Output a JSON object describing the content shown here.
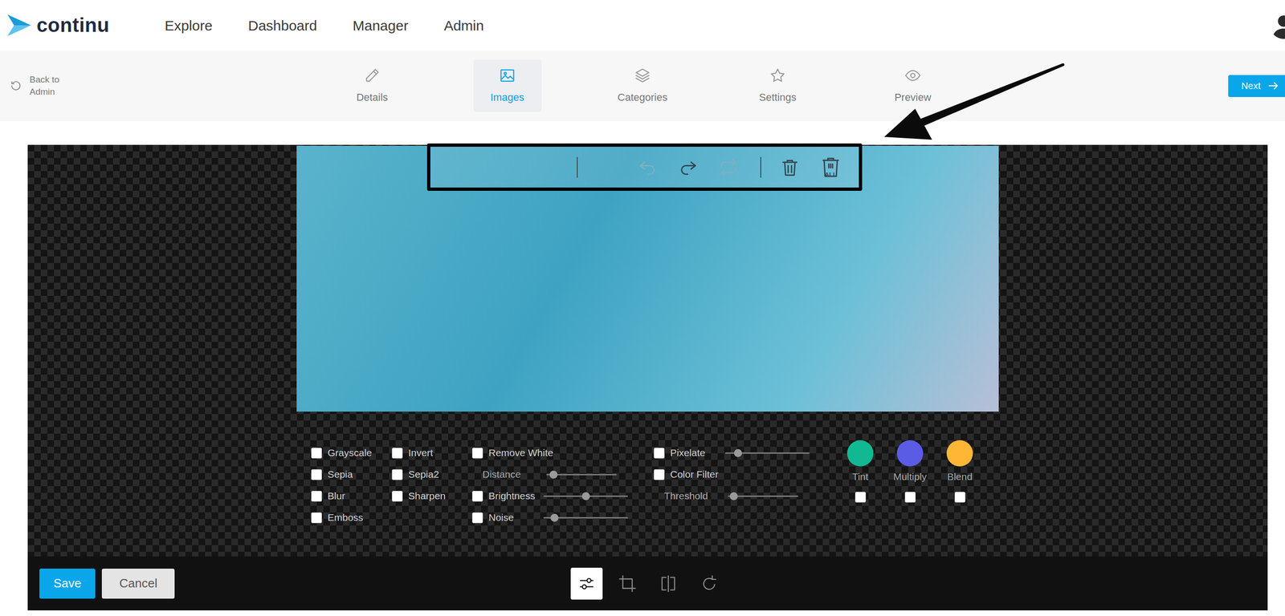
{
  "header": {
    "logo": "continu",
    "nav": [
      {
        "label": "Explore"
      },
      {
        "label": "Dashboard"
      },
      {
        "label": "Manager"
      },
      {
        "label": "Admin"
      }
    ]
  },
  "subnav": {
    "back": [
      "Back to",
      "Admin"
    ],
    "tabs": [
      {
        "label": "Details",
        "selected": false
      },
      {
        "label": "Images",
        "selected": true
      },
      {
        "label": "Categories",
        "selected": false
      },
      {
        "label": "Settings",
        "selected": false
      },
      {
        "label": "Preview",
        "selected": false
      }
    ],
    "next": "Next"
  },
  "editor": {
    "toolbar": {
      "history": [
        {
          "disabled": true
        },
        {
          "disabled": false
        },
        {
          "disabled": true
        }
      ],
      "delete_all_label": "ALL"
    },
    "filters": {
      "columns": [
        [
          {
            "kind": "checkbox",
            "label": "Grayscale",
            "checked": false
          },
          {
            "kind": "checkbox",
            "label": "Sepia",
            "checked": false
          },
          {
            "kind": "checkbox",
            "label": "Blur",
            "checked": false
          },
          {
            "kind": "checkbox",
            "label": "Emboss",
            "checked": false
          }
        ],
        [
          {
            "kind": "checkbox",
            "label": "Invert",
            "checked": false
          },
          {
            "kind": "checkbox",
            "label": "Sepia2",
            "checked": false
          },
          {
            "kind": "checkbox",
            "label": "Sharpen",
            "checked": false
          }
        ],
        [
          {
            "kind": "checkbox",
            "label": "Remove White",
            "checked": false
          },
          {
            "kind": "slider",
            "label": "Distance",
            "level": 0.1
          },
          {
            "kind": "check-slider",
            "label": "Brightness",
            "checked": false,
            "level": 0.5
          },
          {
            "kind": "check-slider",
            "label": "Noise",
            "checked": false,
            "level": 0.13
          }
        ],
        [
          {
            "kind": "check-slider",
            "label": "Pixelate",
            "checked": false,
            "level": 0.15
          },
          {
            "kind": "checkbox",
            "label": "Color Filter",
            "checked": false
          },
          {
            "kind": "slider",
            "label": "Threshold",
            "level": 0.08
          }
        ]
      ],
      "blends": [
        {
          "label": "Tint",
          "color": "#12b892",
          "checked": false
        },
        {
          "label": "Multiply",
          "color": "#5b5ce6",
          "checked": false
        },
        {
          "label": "Blend",
          "color": "#ffb636",
          "checked": false
        }
      ]
    },
    "modes": [
      {
        "selected": true
      },
      {
        "selected": false
      },
      {
        "selected": false
      },
      {
        "selected": false
      }
    ],
    "buttons": {
      "save": "Save",
      "cancel": "Cancel"
    }
  }
}
